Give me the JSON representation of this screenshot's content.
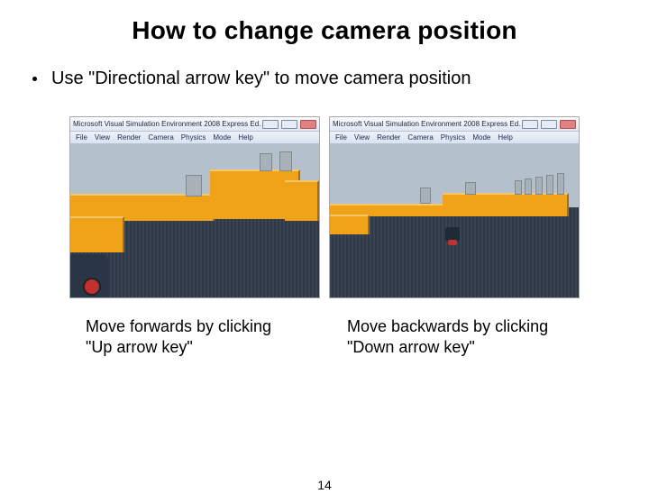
{
  "title": "How to change camera position",
  "bullet": "Use \"Directional arrow key\" to move camera position",
  "screenshots": {
    "app_title": "Microsoft Visual Simulation Environment 2008 Express Ed.",
    "menu": [
      "File",
      "View",
      "Render",
      "Camera",
      "Physics",
      "Mode",
      "Help"
    ]
  },
  "captions": {
    "left_line1": "Move forwards by clicking",
    "left_line2": "\"Up arrow key\"",
    "right_line1": "Move backwards by clicking",
    "right_line2": "\"Down arrow key\""
  },
  "page_number": "14"
}
